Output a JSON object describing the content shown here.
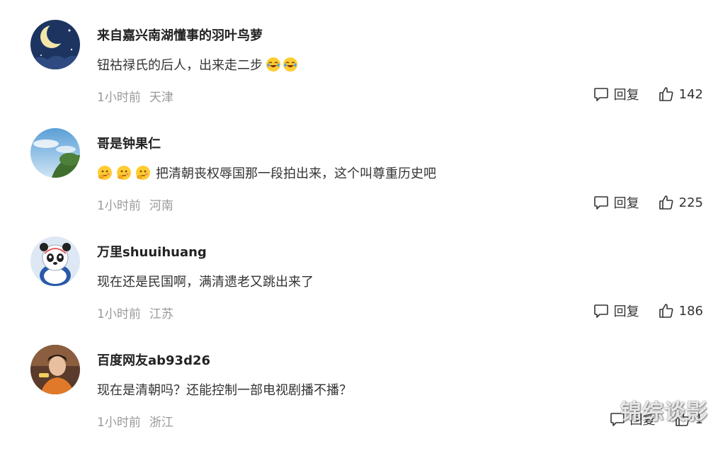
{
  "comments": [
    {
      "username": "来自嘉兴南湖懂事的羽叶鸟萝",
      "text": "钮祜禄氏的后人，出来走二步",
      "time": "1小时前",
      "location": "天津",
      "reply_label": "回复",
      "likes": "142",
      "avatar_icon": "moon-night-avatar",
      "emoji_icon": "laughing-tears-emoji"
    },
    {
      "username": "哥是钟果仁",
      "text": "把清朝丧权辱国那一段拍出来，这个叫尊重历史吧",
      "time": "1小时前",
      "location": "河南",
      "reply_label": "回复",
      "likes": "225",
      "avatar_icon": "sky-tree-avatar",
      "emoji_icon": "thinking-emoji"
    },
    {
      "username": "万里shuuihuang",
      "text": "现在还是民国啊，满清遗老又跳出来了",
      "time": "1小时前",
      "location": "江苏",
      "reply_label": "回复",
      "likes": "186",
      "avatar_icon": "panda-mascot-avatar"
    },
    {
      "username": "百度网友ab93d26",
      "text": "现在是清朝吗？还能控制一部电视剧播不播？",
      "time": "1小时前",
      "location": "浙江",
      "reply_label": "回复",
      "likes": "1",
      "avatar_icon": "person-photo-avatar"
    }
  ],
  "watermark": "锦综谈影",
  "colors": {
    "meta": "#999999",
    "text": "#333333",
    "username": "#222222"
  }
}
